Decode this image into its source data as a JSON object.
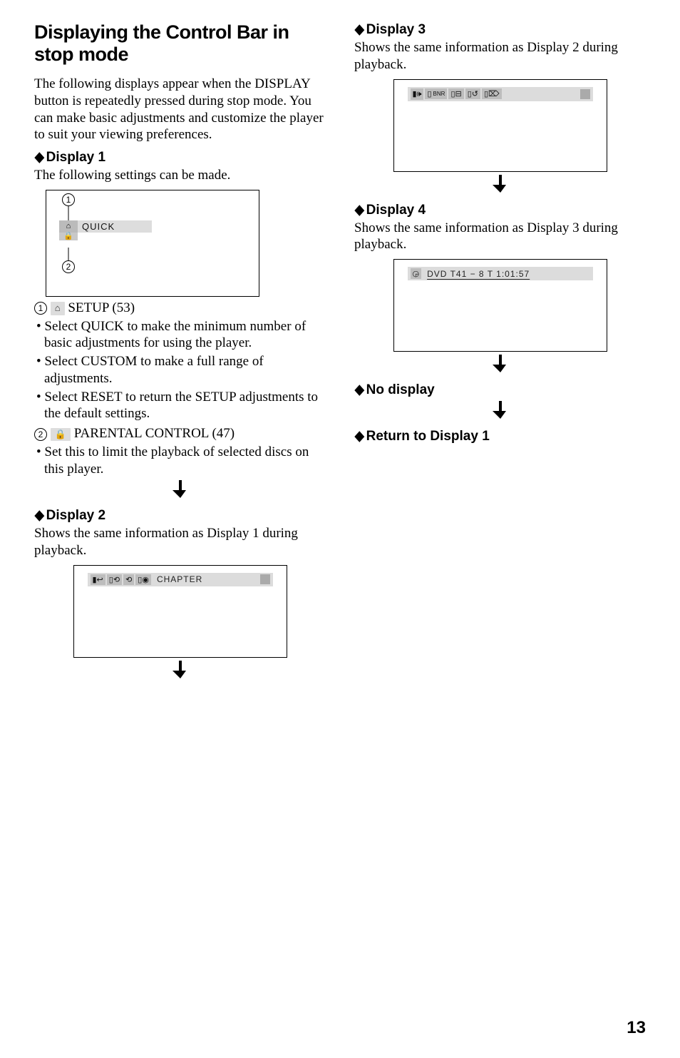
{
  "left": {
    "heading": "Displaying the Control Bar in stop mode",
    "intro": "The following displays appear when the DISPLAY button is repeatedly pressed during stop mode. You can make basic adjustments and customize the player to suit your viewing preferences.",
    "d1_title": "Display 1",
    "d1_body": "The following settings can be made.",
    "screen1_quick": "QUICK",
    "item1_label": "SETUP (53)",
    "item1_b1": "Select QUICK to make the minimum number of basic adjustments for using the player.",
    "item1_b2": "Select CUSTOM to make a full range of adjustments.",
    "item1_b3": "Select RESET to return the SETUP adjustments to the default settings.",
    "item2_label": "PARENTAL CONTROL (47)",
    "item2_b1": "Set this to limit the playback of selected discs on this player.",
    "d2_title": "Display 2",
    "d2_body": "Shows the same information as Display 1 during playback.",
    "screen2_label": "CHAPTER"
  },
  "right": {
    "d3_title": "Display 3",
    "d3_body": "Shows the same information as Display 2 during playback.",
    "d4_title": "Display 4",
    "d4_body": "Shows the same information as Display 3 during playback.",
    "screen4_text": "DVD T41 −   8    T  1:01:57",
    "nodisplay": "No display",
    "return": "Return to Display 1"
  },
  "page": "13",
  "num1": "1",
  "num2": "2"
}
